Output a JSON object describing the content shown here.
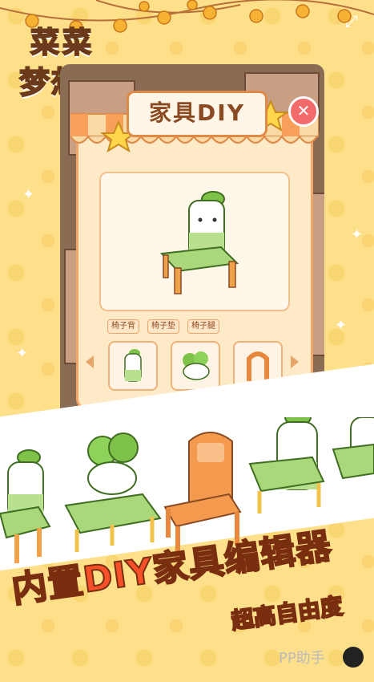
{
  "logo": {
    "line1": "菜菜",
    "line2": "梦想家"
  },
  "panel": {
    "title": "家具DIY",
    "parts": [
      "椅子背",
      "椅子垫",
      "椅子腿"
    ],
    "styles": [
      "radish-back",
      "cabbage-back",
      "wood-back"
    ]
  },
  "promo": {
    "slogan_prefix": "内置",
    "slogan_diy": "DIY",
    "slogan_suffix": "家具编辑器",
    "subslogan": "超高自由度"
  },
  "watermark": {
    "text": "PP助手"
  },
  "colors": {
    "background": "#ffe08a",
    "accent": "#f36a6a",
    "slogan": "#ff7a3a",
    "panel": "#ffeac7"
  }
}
